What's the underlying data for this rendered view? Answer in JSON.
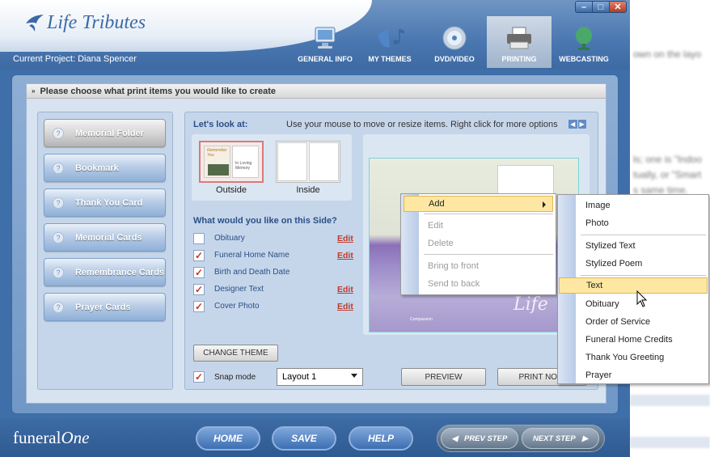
{
  "window": {
    "app_title": "Life Tributes",
    "project_label": "Current Project: Diana Spencer",
    "minimize": "–",
    "maximize": "□",
    "close": "✕"
  },
  "nav": {
    "tabs": [
      {
        "label": "GENERAL INFO",
        "icon": "monitor-icon",
        "active": false
      },
      {
        "label": "MY THEMES",
        "icon": "music-notes-icon",
        "active": false
      },
      {
        "label": "DVD/VIDEO",
        "icon": "disc-icon",
        "active": false
      },
      {
        "label": "PRINTING",
        "icon": "printer-icon",
        "active": true
      },
      {
        "label": "WEBCASTING",
        "icon": "satellite-dish-icon",
        "active": false
      }
    ]
  },
  "main": {
    "title": "Please choose what print items you would like to create",
    "print_items": [
      {
        "label": "Memorial Folder",
        "active": true
      },
      {
        "label": "Bookmark",
        "active": false
      },
      {
        "label": "Thank You Card",
        "active": false
      },
      {
        "label": "Memorial Cards",
        "active": false
      },
      {
        "label": "Remembrance Cards",
        "active": false
      },
      {
        "label": "Prayer Cards",
        "active": false
      }
    ],
    "lets_look": "Let's look at:",
    "hint": "Use your mouse to move or resize items. Right click for more options",
    "nav_arrows": {
      "left": "◀",
      "right": "▶"
    },
    "sides": [
      {
        "label": "Outside",
        "selected": true,
        "thumb_text_left": "Remember You",
        "thumb_text_right": "In Loving Memory"
      },
      {
        "label": "Inside",
        "selected": false
      }
    ],
    "question": "What would you like on this Side?",
    "options": [
      {
        "label": "Obituary",
        "checked": false,
        "edit": "Edit"
      },
      {
        "label": "Funeral Home Name",
        "checked": true,
        "edit": "Edit"
      },
      {
        "label": "Birth and Death Date",
        "checked": true,
        "edit": ""
      },
      {
        "label": "Designer Text",
        "checked": true,
        "edit": "Edit"
      },
      {
        "label": "Cover Photo",
        "checked": true,
        "edit": "Edit"
      }
    ],
    "change_theme": "CHANGE THEME",
    "snap_mode": "Snap mode",
    "snap_checked": true,
    "layout_select": "Layout 1",
    "preview": "PREVIEW",
    "print_now": "PRINT NOW",
    "canvas": {
      "script_text": "Life",
      "small_text": "Compassion"
    }
  },
  "context_menu": {
    "items": [
      {
        "label": "Add",
        "enabled": true,
        "highlighted": true,
        "submenu": true
      },
      {
        "label": "Edit",
        "enabled": false
      },
      {
        "label": "Delete",
        "enabled": false
      },
      {
        "label": "Bring to front",
        "enabled": false
      },
      {
        "label": "Send to back",
        "enabled": false
      }
    ]
  },
  "submenu": {
    "items": [
      {
        "label": "Image"
      },
      {
        "label": "Photo"
      },
      {
        "label": "Stylized Text"
      },
      {
        "label": "Stylized Poem"
      },
      {
        "label": "Text",
        "highlighted": true
      },
      {
        "label": "Obituary"
      },
      {
        "label": "Order of Service"
      },
      {
        "label": "Funeral Home Credits"
      },
      {
        "label": "Thank You Greeting"
      },
      {
        "label": "Prayer"
      }
    ]
  },
  "footer": {
    "logo_plain": "funeral",
    "logo_italic": "One",
    "home": "HOME",
    "save": "SAVE",
    "help": "HELP",
    "prev_step": "PREV STEP",
    "next_step": "NEXT STEP"
  },
  "background_window": {
    "lines": [
      "own on the layo",
      "ls; one is \"Indoo",
      "tually, or \"Smart",
      "s same time."
    ]
  },
  "colors": {
    "accent": "#3f6fa8",
    "highlight": "#fde7a3",
    "edit_link": "#c0392b"
  }
}
